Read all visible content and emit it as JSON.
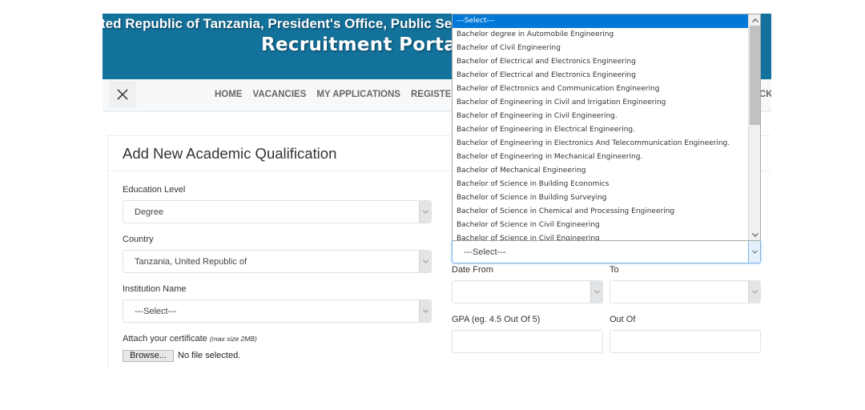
{
  "banner": {
    "line1": "ted Republic of Tanzania, President's Office, Public Service Recruitment Secretariat",
    "line2": "Recruitment Portal"
  },
  "nav": {
    "close_label": "close",
    "items": [
      "HOME",
      "VACANCIES",
      "MY APPLICATIONS",
      "REGISTER"
    ],
    "right_partial": "CK"
  },
  "form": {
    "title": "Add New Academic Qualification",
    "education_level": {
      "label": "Education Level",
      "value": "Degree"
    },
    "country": {
      "label": "Country",
      "value": "Tanzania, United Republic of"
    },
    "institution": {
      "label": "Institution Name",
      "value": "---Select---"
    },
    "certificate": {
      "label": "Attach your certificate",
      "hint": "(max size 2MB)",
      "browse_label": "Browse...",
      "status": "No file selected."
    },
    "programme": {
      "value": "---Select---"
    },
    "date_from": {
      "label": "Date From",
      "value": ""
    },
    "date_to": {
      "label": "To",
      "value": ""
    },
    "gpa": {
      "label": "GPA (eg. 4.5 Out Of 5)",
      "value": ""
    },
    "out_of": {
      "label": "Out Of",
      "value": ""
    }
  },
  "dropdown": {
    "selected_index": 0,
    "options": [
      "---Select---",
      "Bachelor degree in Automobile Engineering",
      "Bachelor of Civil Engineering",
      "Bachelor of Electrical and Electronics Engineering",
      "Bachelor of Electrical and Electronics Engineering",
      "Bachelor of Electronics and Communication Engineering",
      "Bachelor of Engineering in Civil and Irrigation Engineering",
      "Bachelor of Engineering in Civil Engineering.",
      "Bachelor of Engineering in Electrical Engineering.",
      "Bachelor of Engineering in Electronics And Telecommunication Engineering.",
      "Bachelor of Engineering in Mechanical Engineering.",
      "Bachelor of Mechanical Engineering",
      "Bachelor of Science in Building Economics",
      "Bachelor of Science in Building Surveying",
      "Bachelor of Science in Chemical and Processing Engineering",
      "Bachelor of Science in Civil Engineering",
      "Bachelor of Science in Civil Engineering"
    ]
  },
  "colors": {
    "banner": "#13729b",
    "selected_option": "#0078d7",
    "focus_border": "#7fb3e6"
  }
}
